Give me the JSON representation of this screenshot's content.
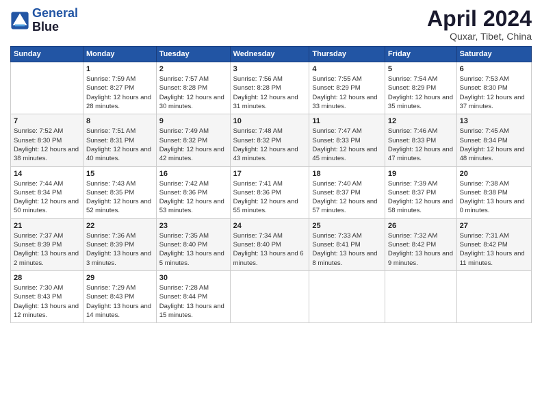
{
  "logo": {
    "line1": "General",
    "line2": "Blue"
  },
  "title": "April 2024",
  "subtitle": "Quxar, Tibet, China",
  "days_header": [
    "Sunday",
    "Monday",
    "Tuesday",
    "Wednesday",
    "Thursday",
    "Friday",
    "Saturday"
  ],
  "weeks": [
    [
      {
        "day": "",
        "content": ""
      },
      {
        "day": "1",
        "content": "Sunrise: 7:59 AM\nSunset: 8:27 PM\nDaylight: 12 hours and 28 minutes."
      },
      {
        "day": "2",
        "content": "Sunrise: 7:57 AM\nSunset: 8:28 PM\nDaylight: 12 hours and 30 minutes."
      },
      {
        "day": "3",
        "content": "Sunrise: 7:56 AM\nSunset: 8:28 PM\nDaylight: 12 hours and 31 minutes."
      },
      {
        "day": "4",
        "content": "Sunrise: 7:55 AM\nSunset: 8:29 PM\nDaylight: 12 hours and 33 minutes."
      },
      {
        "day": "5",
        "content": "Sunrise: 7:54 AM\nSunset: 8:29 PM\nDaylight: 12 hours and 35 minutes."
      },
      {
        "day": "6",
        "content": "Sunrise: 7:53 AM\nSunset: 8:30 PM\nDaylight: 12 hours and 37 minutes."
      }
    ],
    [
      {
        "day": "7",
        "content": "Sunrise: 7:52 AM\nSunset: 8:30 PM\nDaylight: 12 hours and 38 minutes."
      },
      {
        "day": "8",
        "content": "Sunrise: 7:51 AM\nSunset: 8:31 PM\nDaylight: 12 hours and 40 minutes."
      },
      {
        "day": "9",
        "content": "Sunrise: 7:49 AM\nSunset: 8:32 PM\nDaylight: 12 hours and 42 minutes."
      },
      {
        "day": "10",
        "content": "Sunrise: 7:48 AM\nSunset: 8:32 PM\nDaylight: 12 hours and 43 minutes."
      },
      {
        "day": "11",
        "content": "Sunrise: 7:47 AM\nSunset: 8:33 PM\nDaylight: 12 hours and 45 minutes."
      },
      {
        "day": "12",
        "content": "Sunrise: 7:46 AM\nSunset: 8:33 PM\nDaylight: 12 hours and 47 minutes."
      },
      {
        "day": "13",
        "content": "Sunrise: 7:45 AM\nSunset: 8:34 PM\nDaylight: 12 hours and 48 minutes."
      }
    ],
    [
      {
        "day": "14",
        "content": "Sunrise: 7:44 AM\nSunset: 8:34 PM\nDaylight: 12 hours and 50 minutes."
      },
      {
        "day": "15",
        "content": "Sunrise: 7:43 AM\nSunset: 8:35 PM\nDaylight: 12 hours and 52 minutes."
      },
      {
        "day": "16",
        "content": "Sunrise: 7:42 AM\nSunset: 8:36 PM\nDaylight: 12 hours and 53 minutes."
      },
      {
        "day": "17",
        "content": "Sunrise: 7:41 AM\nSunset: 8:36 PM\nDaylight: 12 hours and 55 minutes."
      },
      {
        "day": "18",
        "content": "Sunrise: 7:40 AM\nSunset: 8:37 PM\nDaylight: 12 hours and 57 minutes."
      },
      {
        "day": "19",
        "content": "Sunrise: 7:39 AM\nSunset: 8:37 PM\nDaylight: 12 hours and 58 minutes."
      },
      {
        "day": "20",
        "content": "Sunrise: 7:38 AM\nSunset: 8:38 PM\nDaylight: 13 hours and 0 minutes."
      }
    ],
    [
      {
        "day": "21",
        "content": "Sunrise: 7:37 AM\nSunset: 8:39 PM\nDaylight: 13 hours and 2 minutes."
      },
      {
        "day": "22",
        "content": "Sunrise: 7:36 AM\nSunset: 8:39 PM\nDaylight: 13 hours and 3 minutes."
      },
      {
        "day": "23",
        "content": "Sunrise: 7:35 AM\nSunset: 8:40 PM\nDaylight: 13 hours and 5 minutes."
      },
      {
        "day": "24",
        "content": "Sunrise: 7:34 AM\nSunset: 8:40 PM\nDaylight: 13 hours and 6 minutes."
      },
      {
        "day": "25",
        "content": "Sunrise: 7:33 AM\nSunset: 8:41 PM\nDaylight: 13 hours and 8 minutes."
      },
      {
        "day": "26",
        "content": "Sunrise: 7:32 AM\nSunset: 8:42 PM\nDaylight: 13 hours and 9 minutes."
      },
      {
        "day": "27",
        "content": "Sunrise: 7:31 AM\nSunset: 8:42 PM\nDaylight: 13 hours and 11 minutes."
      }
    ],
    [
      {
        "day": "28",
        "content": "Sunrise: 7:30 AM\nSunset: 8:43 PM\nDaylight: 13 hours and 12 minutes."
      },
      {
        "day": "29",
        "content": "Sunrise: 7:29 AM\nSunset: 8:43 PM\nDaylight: 13 hours and 14 minutes."
      },
      {
        "day": "30",
        "content": "Sunrise: 7:28 AM\nSunset: 8:44 PM\nDaylight: 13 hours and 15 minutes."
      },
      {
        "day": "",
        "content": ""
      },
      {
        "day": "",
        "content": ""
      },
      {
        "day": "",
        "content": ""
      },
      {
        "day": "",
        "content": ""
      }
    ]
  ]
}
